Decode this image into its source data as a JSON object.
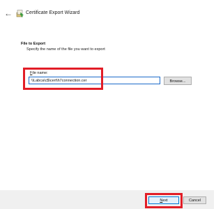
{
  "header": {
    "back_glyph": "←",
    "title": "Certificate Export Wizard",
    "icon": "certificate-wizard-icon"
  },
  "section": {
    "title": "File to Export",
    "description": "Specify the name of the file you want to export"
  },
  "file_field": {
    "label_prefix": "",
    "label_mnemonic": "F",
    "label_rest": "ile name:",
    "value": "\\\\Labca\\c$\\cert\\h7connection.cer"
  },
  "buttons": {
    "browse": "Browse...",
    "next_mnemonic": "N",
    "next_rest": "ext",
    "cancel": "Cancel"
  },
  "colors": {
    "highlight": "#e21d27",
    "focus_border": "#1b6ac9",
    "default_button_border": "#0078d7"
  }
}
